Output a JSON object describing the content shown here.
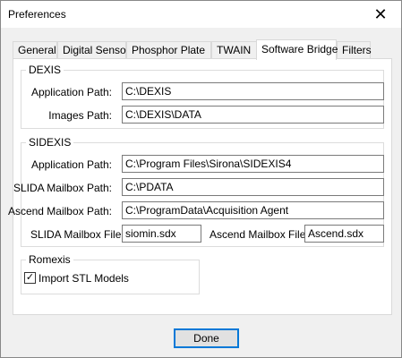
{
  "window": {
    "title": "Preferences",
    "close_glyph": "✕"
  },
  "tabs": [
    {
      "label": "General"
    },
    {
      "label": "Digital Sensor"
    },
    {
      "label": "Phosphor Plate"
    },
    {
      "label": "TWAIN"
    },
    {
      "label": "Software Bridge",
      "active": true
    },
    {
      "label": "Filters"
    }
  ],
  "dexis": {
    "title": "DEXIS",
    "app_path_label": "Application Path:",
    "app_path_value": "C:\\DEXIS",
    "images_path_label": "Images Path:",
    "images_path_value": "C:\\DEXIS\\DATA"
  },
  "sidexis": {
    "title": "SIDEXIS",
    "app_path_label": "Application Path:",
    "app_path_value": "C:\\Program Files\\Sirona\\SIDEXIS4",
    "slida_mailbox_path_label": "SLIDA Mailbox Path:",
    "slida_mailbox_path_value": "C:\\PDATA",
    "ascend_mailbox_path_label": "Ascend Mailbox Path:",
    "ascend_mailbox_path_value": "C:\\ProgramData\\Acquisition Agent",
    "slida_mailbox_file_label": "SLIDA Mailbox File:",
    "slida_mailbox_file_value": "siomin.sdx",
    "ascend_mailbox_file_label": "Ascend Mailbox File:",
    "ascend_mailbox_file_value": "Ascend.sdx"
  },
  "romexis": {
    "title": "Romexis",
    "import_stl_label": "Import STL Models",
    "import_stl_checked": true,
    "check_glyph": "✓"
  },
  "footer": {
    "done_label": "Done"
  }
}
